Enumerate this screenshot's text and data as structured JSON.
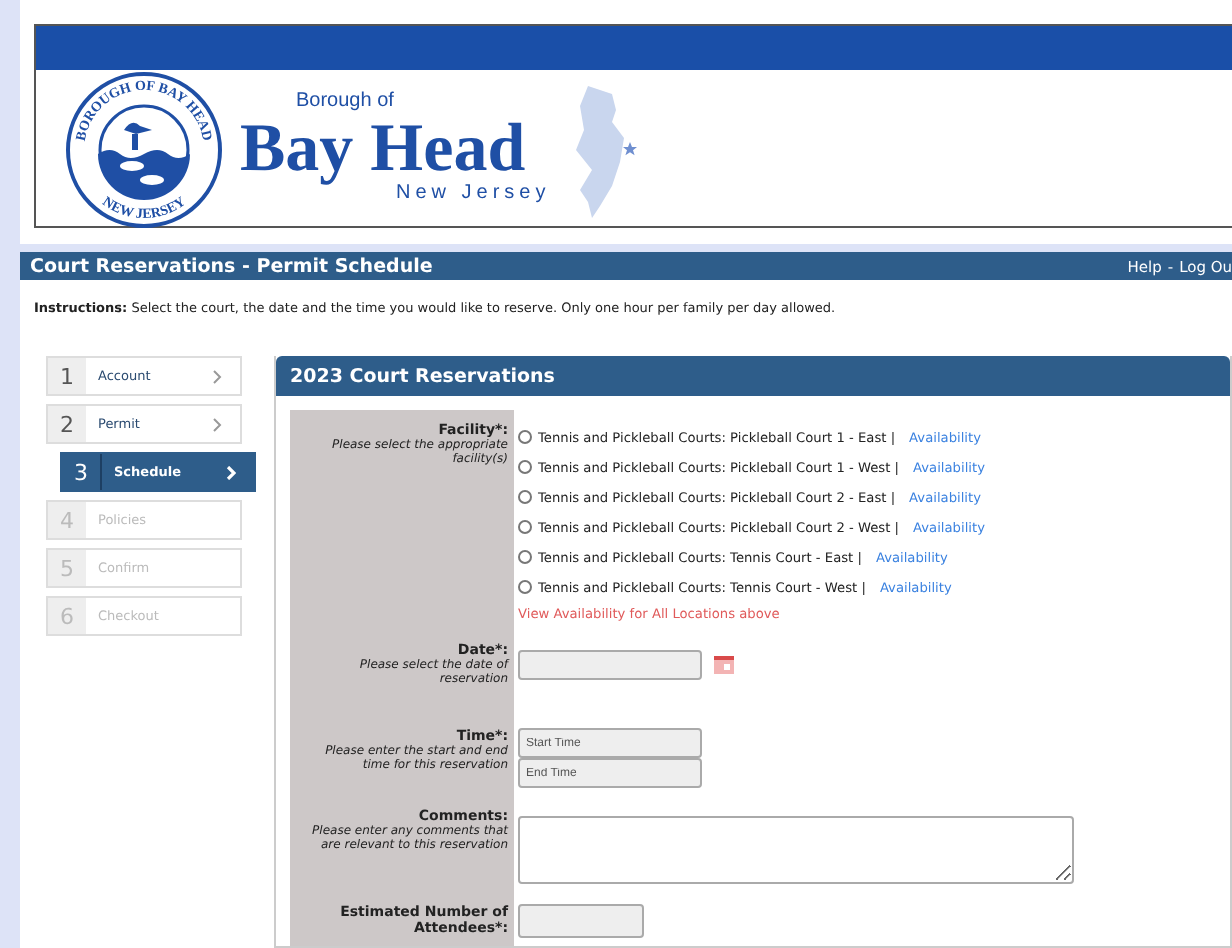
{
  "header": {
    "seal_top": "BOROUGH OF BAY HEAD",
    "seal_bottom": "NEW JERSEY",
    "org_prefix": "Borough of",
    "org_name": "Bay Head",
    "org_state": "New Jersey"
  },
  "title_bar": {
    "title": "Court Reservations - Permit Schedule",
    "links": [
      "Help",
      "-",
      "Log Ou"
    ]
  },
  "instructions": {
    "label": "Instructions:",
    "text": "Select the court, the date and the time you would like to reserve. Only one hour per family per day allowed."
  },
  "steps": [
    {
      "number": "1",
      "label": "Account",
      "selected": false,
      "disabled": false
    },
    {
      "number": "2",
      "label": "Permit",
      "selected": false,
      "disabled": false
    },
    {
      "number": "3",
      "label": "Schedule",
      "selected": true,
      "disabled": false
    },
    {
      "number": "4",
      "label": "Policies",
      "selected": false,
      "disabled": true
    },
    {
      "number": "5",
      "label": "Confirm",
      "selected": false,
      "disabled": true
    },
    {
      "number": "6",
      "label": "Checkout",
      "selected": false,
      "disabled": true
    }
  ],
  "panel": {
    "title": "2023 Court Reservations",
    "fields": [
      {
        "kind": "facility",
        "label": "Facility*:",
        "hint": "Please select the appropriate facility(s)",
        "options": [
          {
            "label": "Tennis and Pickleball Courts: Pickleball Court 1 - East |",
            "link": "Availability",
            "selected": false
          },
          {
            "label": "Tennis and Pickleball Courts: Pickleball Court 1 - West |",
            "link": "Availability",
            "selected": false
          },
          {
            "label": "Tennis and Pickleball Courts: Pickleball Court 2 - East |",
            "link": "Availability",
            "selected": false
          },
          {
            "label": "Tennis and Pickleball Courts: Pickleball Court 2 - West |",
            "link": "Availability",
            "selected": false
          },
          {
            "label": "Tennis and Pickleball Courts: Tennis Court - East |",
            "link": "Availability",
            "selected": false
          },
          {
            "label": "Tennis and Pickleball Courts: Tennis Court - West |",
            "link": "Availability",
            "selected": false
          }
        ],
        "all_link": "View Availability for All Locations above"
      },
      {
        "kind": "date",
        "label": "Date*:",
        "hint": "Please select the date of reservation"
      },
      {
        "kind": "time",
        "label": "Time*:",
        "hint": "Please enter the start and end time for this reservation",
        "placeholders": [
          "Start Time",
          "End Time"
        ]
      },
      {
        "kind": "comments",
        "label": "Comments:",
        "hint": "Please enter any comments that are relevant to this reservation"
      },
      {
        "kind": "number",
        "label": "Estimated Number of Attendees*:"
      }
    ]
  }
}
